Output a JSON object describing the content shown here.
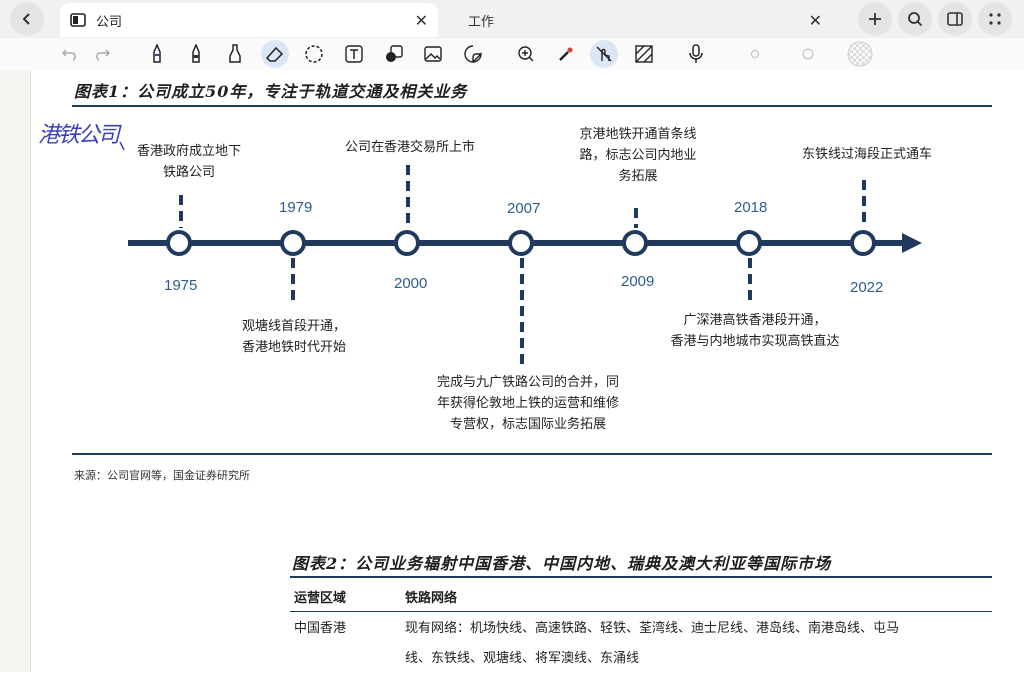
{
  "tabs": [
    {
      "label": "公司",
      "active": true,
      "close": "✕"
    },
    {
      "label": "工作",
      "active": false,
      "close": "✕"
    }
  ],
  "toolbar_icons": [
    "undo-icon",
    "redo-icon",
    "pen-icon",
    "marker-icon",
    "highlighter-icon",
    "eraser-icon",
    "lasso-icon",
    "text-icon",
    "shape-icon",
    "image-icon",
    "sticker-icon",
    "zoom-icon",
    "laser-icon",
    "touch-icon",
    "pattern-icon",
    "mic-icon",
    "thin-dot-icon",
    "medium-dot-icon",
    "color-swatch-icon"
  ],
  "figure1": {
    "title": "图表1：公司成立50年，专注于轨道交通及相关业务",
    "events": [
      {
        "year": "1975",
        "text": [
          "香港政府成立地下",
          "铁路公司"
        ]
      },
      {
        "year": "1979",
        "text": [
          "观塘线首段开通，",
          "香港地铁时代开始"
        ]
      },
      {
        "year": "2000",
        "text": [
          "公司在香港交易所上市"
        ]
      },
      {
        "year": "2007",
        "text": [
          "完成与九广铁路公司的合并，同",
          "年获得伦敦地上铁的运营和维修",
          "专营权，标志国际业务拓展"
        ]
      },
      {
        "year": "2009",
        "text": [
          "京港地铁开通首条线",
          "路，标志公司内地业",
          "务拓展"
        ]
      },
      {
        "year": "2018",
        "text": [
          "广深港高铁香港段开通，",
          "香港与内地城市实现高铁直达"
        ]
      },
      {
        "year": "2022",
        "text": [
          "东铁线过海段正式通车"
        ]
      }
    ],
    "source": "来源：公司官网等，国金证券研究所"
  },
  "handwriting": "港铁公司",
  "figure2": {
    "title": "图表2：公司业务辐射中国香港、中国内地、瑞典及澳大利亚等国际市场",
    "headers": [
      "运营区域",
      "铁路网络"
    ],
    "rows": [
      {
        "region": "中国香港",
        "lines": [
          "现有网络：机场快线、高速铁路、轻铁、荃湾线、迪士尼线、港岛线、南港岛线、屯马",
          "线、东铁线、观塘线、将军澳线、东涌线"
        ]
      }
    ]
  },
  "colors": {
    "accent": "#1f3a5e",
    "year": "#2d5d8e",
    "ink": "#3b3fb8"
  }
}
